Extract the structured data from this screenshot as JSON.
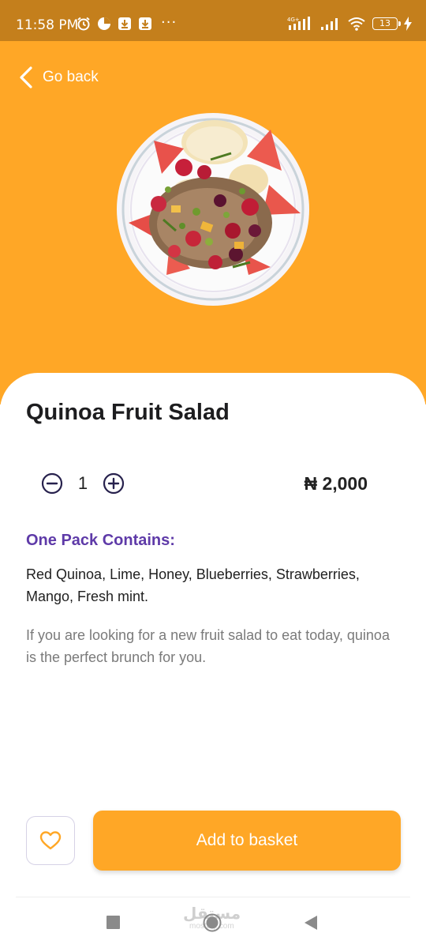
{
  "status_bar": {
    "time": "11:58 PM",
    "dots": "···",
    "network": "4G+",
    "battery": "13",
    "icons": [
      "alarm-icon",
      "app-icon",
      "download-icon",
      "download-icon",
      "signal-icon",
      "signal-icon",
      "wifi-icon",
      "battery-icon",
      "charging-icon"
    ]
  },
  "header": {
    "back_label": "Go back",
    "back_icon": "chevron-left-icon",
    "hero_color": "#ffa726",
    "image": "fruit-salad-plate-image"
  },
  "product": {
    "title": "Quinoa Fruit Salad",
    "quantity": "1",
    "price": "₦ 2,000",
    "contains_heading": "One Pack Contains:",
    "ingredients": "Red Quinoa, Lime, Honey, Blueberries, Strawberries, Mango, Fresh mint.",
    "description": "If you are looking for a new fruit salad to eat today, quinoa is the perfect brunch for you."
  },
  "actions": {
    "favorite_icon": "heart-icon",
    "add_to_basket_label": "Add to basket",
    "accent_color": "#ffa726",
    "heading_color": "#5e3aa8"
  },
  "nav": {
    "icons": [
      "square-recent-icon",
      "circle-home-icon",
      "triangle-back-icon"
    ],
    "watermark": "مستقل",
    "watermark_sub": "mostaql.com"
  }
}
